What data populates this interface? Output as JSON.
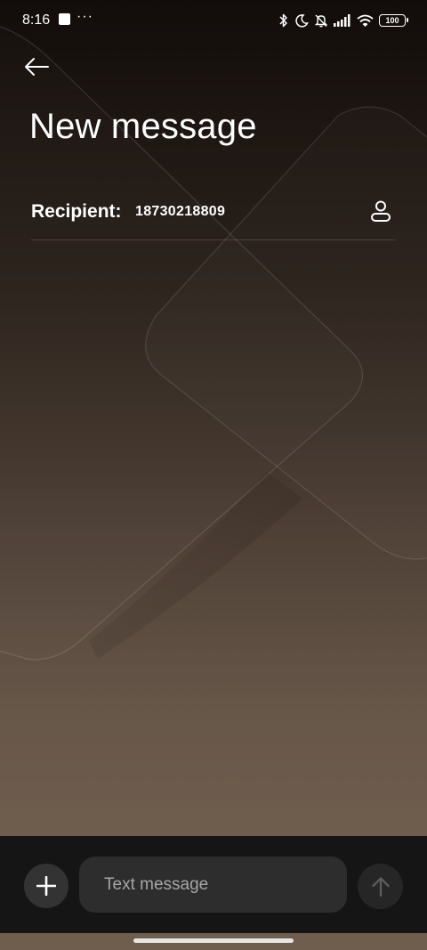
{
  "status_bar": {
    "time": "8:16",
    "dots": "···",
    "battery": "100",
    "icons": [
      "notification-square-icon",
      "bluetooth-icon",
      "do-not-disturb-moon-icon",
      "muted-bell-icon",
      "cellular-signal-icon",
      "wifi-icon",
      "battery-icon"
    ]
  },
  "header": {
    "back_icon": "arrow-left-icon",
    "title": "New message"
  },
  "recipient": {
    "label": "Recipient:",
    "value": "18730218809",
    "contact_icon": "person-contact-icon"
  },
  "composer": {
    "add_icon": "plus-icon",
    "placeholder": "Text message",
    "value": "",
    "send_icon": "arrow-up-icon"
  },
  "colors": {
    "background_top": "#120d0a",
    "background_bottom": "#6f5d4d",
    "composer_bar": "#151515",
    "input_bg": "#2d2d2d",
    "text": "#ffffff",
    "placeholder": "#a6a6a6"
  }
}
